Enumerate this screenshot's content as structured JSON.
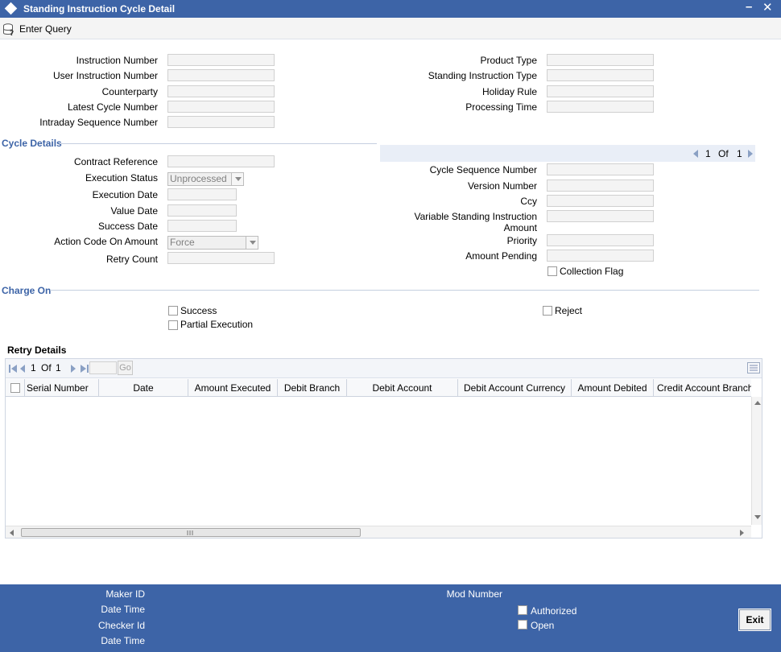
{
  "window": {
    "title": "Standing Instruction Cycle Detail"
  },
  "toolbar": {
    "enter_query": "Enter Query"
  },
  "header_left": [
    {
      "label": "Instruction Number",
      "value": ""
    },
    {
      "label": "User Instruction Number",
      "value": ""
    },
    {
      "label": "Counterparty",
      "value": ""
    },
    {
      "label": "Latest Cycle Number",
      "value": ""
    },
    {
      "label": "Intraday Sequence Number",
      "value": ""
    }
  ],
  "header_right": [
    {
      "label": "Product Type",
      "value": ""
    },
    {
      "label": "Standing Instruction Type",
      "value": ""
    },
    {
      "label": "Holiday Rule",
      "value": ""
    },
    {
      "label": "Processing Time",
      "value": ""
    }
  ],
  "cycle_details": {
    "title": "Cycle Details",
    "pager": {
      "current": "1",
      "of": "Of",
      "total": "1"
    },
    "contract_reference": {
      "label": "Contract Reference",
      "value": ""
    },
    "execution_status": {
      "label": "Execution Status",
      "value": "Unprocessed"
    },
    "execution_date": {
      "label": "Execution Date",
      "value": ""
    },
    "value_date": {
      "label": "Value Date",
      "value": ""
    },
    "success_date": {
      "label": "Success Date",
      "value": ""
    },
    "action_code": {
      "label": "Action Code On Amount",
      "value": "Force"
    },
    "retry_count": {
      "label": "Retry Count",
      "value": ""
    },
    "cycle_sequence_number": {
      "label": "Cycle Sequence Number",
      "value": ""
    },
    "version_number": {
      "label": "Version Number",
      "value": ""
    },
    "ccy": {
      "label": "Ccy",
      "value": ""
    },
    "variable_si_amount": {
      "label_line1": "Variable Standing Instruction",
      "label_line2": "Amount",
      "value": ""
    },
    "priority": {
      "label": "Priority",
      "value": ""
    },
    "amount_pending": {
      "label": "Amount Pending",
      "value": ""
    },
    "collection_flag": {
      "label": "Collection Flag",
      "checked": false
    }
  },
  "charge_on": {
    "title": "Charge On",
    "success": {
      "label": "Success",
      "checked": false
    },
    "partial_execution": {
      "label": "Partial Execution",
      "checked": false
    },
    "reject": {
      "label": "Reject",
      "checked": false
    }
  },
  "retry_details": {
    "title": "Retry Details",
    "pager": {
      "current": "1",
      "of": "Of",
      "total": "1",
      "go": "Go"
    },
    "columns": [
      "Serial Number",
      "Date",
      "Amount Executed",
      "Debit Branch",
      "Debit Account",
      "Debit Account Currency",
      "Amount Debited",
      "Credit Account Branch"
    ],
    "rows": []
  },
  "footer": {
    "maker_id": "Maker ID",
    "date_time_1": "Date Time",
    "checker_id": "Checker Id",
    "date_time_2": "Date Time",
    "mod_number": "Mod Number",
    "authorized": "Authorized",
    "open": "Open",
    "exit": "Exit"
  },
  "colors": {
    "brand": "#3d64a7",
    "section": "#3d64a7"
  },
  "icons": {
    "title": "diamond-icon",
    "enter_query": "query-icon",
    "minimize": "minimize-icon",
    "close": "close-icon"
  }
}
